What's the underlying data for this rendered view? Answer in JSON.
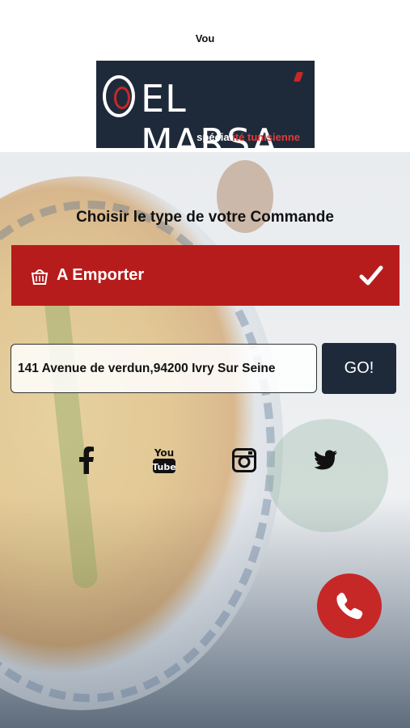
{
  "header": {
    "top_text": "Vou"
  },
  "logo": {
    "brand": "EL MARSA",
    "tagline_part1": "spécial",
    "tagline_part2": "ité tunisienne"
  },
  "order": {
    "heading": "Choisir le type de votre Commande",
    "selected_type": "A Emporter"
  },
  "address": {
    "value": "141 Avenue de verdun,94200 Ivry Sur Seine",
    "go_label": "GO!"
  },
  "social": [
    "facebook-icon",
    "youtube-icon",
    "instagram-icon",
    "twitter-icon"
  ],
  "colors": {
    "brand_red": "#b71c1c",
    "brand_navy": "#1e2a3a"
  }
}
